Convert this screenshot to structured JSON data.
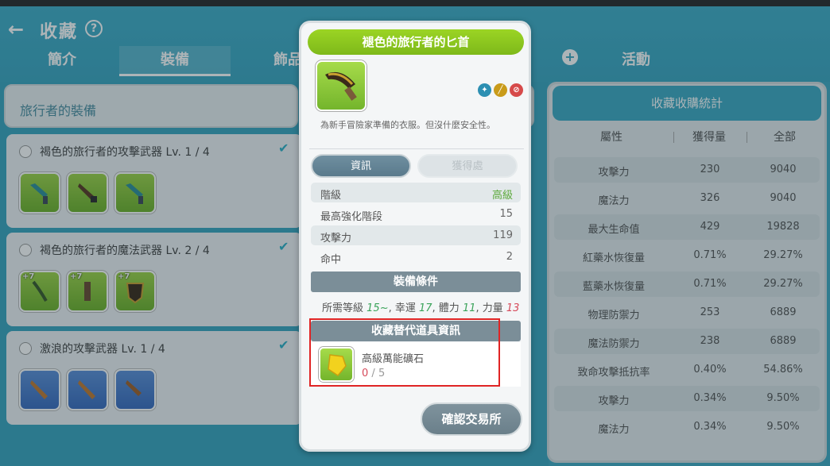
{
  "header": {
    "title": "收藏",
    "help_symbol": "?"
  },
  "tabs": [
    {
      "label": "簡介"
    },
    {
      "label": "裝備"
    },
    {
      "label": "飾品"
    },
    {
      "label": ""
    },
    {
      "label": "活動"
    }
  ],
  "left_panel": {
    "title": "旅行者的裝備",
    "groups": [
      {
        "title": "褐色的旅行者的攻擊武器 Lv. 1 / 4"
      },
      {
        "title": "褐色的旅行者的魔法武器 Lv. 2 / 4",
        "plus": "+7"
      },
      {
        "title": "激浪的攻擊武器 Lv. 1 / 4"
      }
    ]
  },
  "right_panel": {
    "title": "收藏收購統計",
    "columns": [
      "屬性",
      "獲得量",
      "全部"
    ],
    "rows": [
      {
        "attr": "攻擊力",
        "gained": "230",
        "total": "9040"
      },
      {
        "attr": "魔法力",
        "gained": "326",
        "total": "9040"
      },
      {
        "attr": "最大生命值",
        "gained": "429",
        "total": "19828"
      },
      {
        "attr": "紅藥水恢復量",
        "gained": "0.71%",
        "total": "29.27%"
      },
      {
        "attr": "藍藥水恢復量",
        "gained": "0.71%",
        "total": "29.27%"
      },
      {
        "attr": "物理防禦力",
        "gained": "253",
        "total": "6889"
      },
      {
        "attr": "魔法防禦力",
        "gained": "238",
        "total": "6889"
      },
      {
        "attr": "致命攻擊抵抗率",
        "gained": "0.40%",
        "total": "54.86%"
      },
      {
        "attr": "攻擊力",
        "gained": "0.34%",
        "total": "9.50%"
      },
      {
        "attr": "魔法力",
        "gained": "0.34%",
        "total": "9.50%"
      }
    ]
  },
  "modal": {
    "title": "褪色的旅行者的匕首",
    "description": "為新手冒險家準備的衣服。但沒什麼安全性。",
    "tab_info": "資訊",
    "tab_source": "獲得處",
    "stats": [
      {
        "key": "階級",
        "value": "高級"
      },
      {
        "key": "最高強化階段",
        "value": "15"
      },
      {
        "key": "攻擊力",
        "value": "119"
      },
      {
        "key": "命中",
        "value": "2"
      }
    ],
    "requirements_title": "裝備條件",
    "requirements": {
      "level_label": "所需等級",
      "level_value": "15~",
      "luck_label": ", 幸運",
      "luck_value": "17",
      "vit_label": ", 體力",
      "vit_value": "11",
      "str_label": ", 力量",
      "str_value": "13"
    },
    "alt_title": "收藏替代道具資訊",
    "alt_item": {
      "name": "高級萬能礦石",
      "have": "0",
      "sep": " / ",
      "need": "5"
    },
    "confirm_label": "確認交易所"
  },
  "colors": {
    "accent": "#3ba6c1",
    "title_green": "#8cc61f",
    "highlight_red": "#e02424"
  }
}
